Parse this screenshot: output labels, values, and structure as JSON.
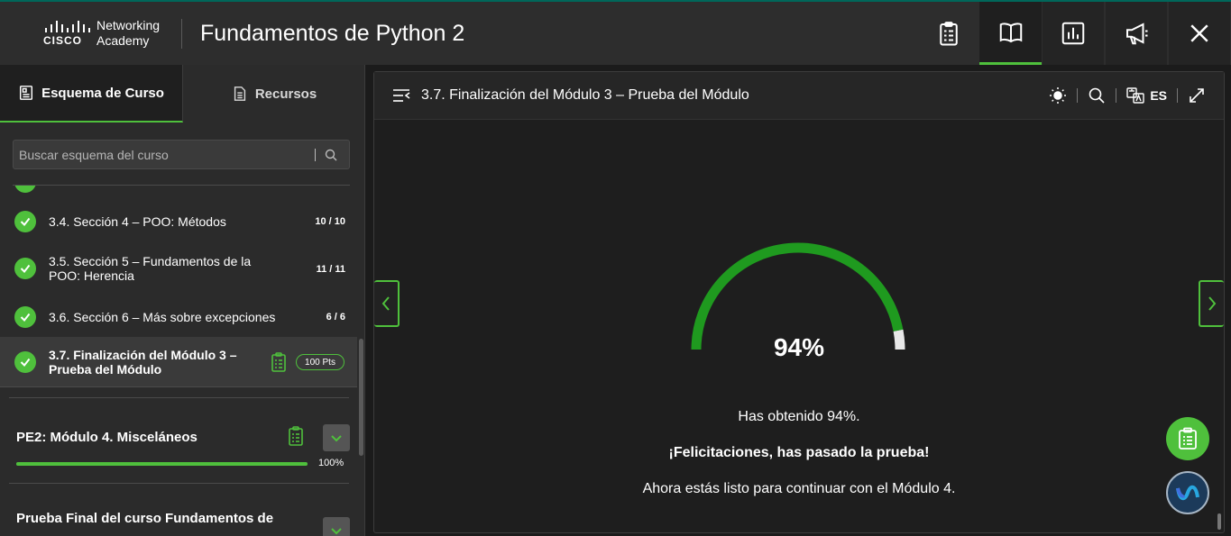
{
  "header": {
    "logo_brand": "CISCO",
    "logo_line1": "Networking",
    "logo_line2": "Academy",
    "title": "Fundamentos de Python 2",
    "buttons": [
      {
        "name": "assignments",
        "icon": "clipboard-icon"
      },
      {
        "name": "course",
        "icon": "book-icon",
        "active": true
      },
      {
        "name": "grades",
        "icon": "chart-icon"
      },
      {
        "name": "announcements",
        "icon": "megaphone-icon"
      },
      {
        "name": "close",
        "icon": "close-icon"
      }
    ]
  },
  "sidebar": {
    "tabs": [
      {
        "label": "Esquema de Curso",
        "active": true
      },
      {
        "label": "Recursos",
        "active": false
      }
    ],
    "search_placeholder": "Buscar esquema del curso",
    "items": [
      {
        "label": "3.4. Sección 4 – POO: Métodos",
        "count": "10 / 10"
      },
      {
        "label": "3.5. Sección 5 – Fundamentos de la POO: Herencia",
        "count": "11 / 11"
      },
      {
        "label": "3.6. Sección 6 – Más sobre excepciones",
        "count": "6 / 6"
      },
      {
        "label": "3.7. Finalización del Módulo 3 – Prueba del Módulo",
        "points": "100 Pts",
        "current": true
      }
    ],
    "sections": [
      {
        "title": "PE2: Módulo 4. Misceláneos",
        "progress": 100,
        "progress_label": "100%"
      },
      {
        "title": "Prueba Final del curso Fundamentos de"
      }
    ]
  },
  "content": {
    "title": "3.7. Finalización del Módulo 3 – Prueba del Módulo",
    "language": "ES",
    "score_value": 94,
    "score_label": "94%",
    "result_line": "Has obtenido 94%.",
    "congrats": "¡Felicitaciones, has pasado la prueba!",
    "next_step": "Ahora estás listo para continuar con el Módulo 4."
  },
  "colors": {
    "accent": "#4fc03c",
    "gauge_fill": "#1f9a1f",
    "gauge_rest": "#e8e8e8",
    "background": "#1e1e1e"
  }
}
